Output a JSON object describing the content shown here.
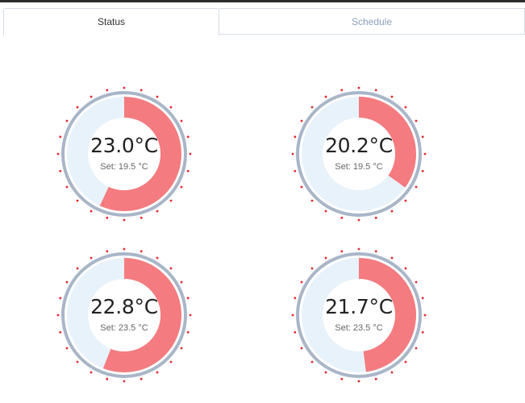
{
  "tabs": [
    {
      "label": "Status",
      "active": true
    },
    {
      "label": "Schedule",
      "active": false
    }
  ],
  "set_prefix": "Set:",
  "colors": {
    "heat": "#f47b7f",
    "track": "#e8f2fa",
    "ring": "#a9b6c8",
    "tick": "#e8242b"
  },
  "gauges": [
    {
      "current": "23.0°C",
      "set": "19.5 °C",
      "fill_fraction": 0.57
    },
    {
      "current": "20.2°C",
      "set": "19.5 °C",
      "fill_fraction": 0.35
    },
    {
      "current": "22.8°C",
      "set": "23.5 °C",
      "fill_fraction": 0.56
    },
    {
      "current": "21.7°C",
      "set": "23.5 °C",
      "fill_fraction": 0.48
    }
  ]
}
